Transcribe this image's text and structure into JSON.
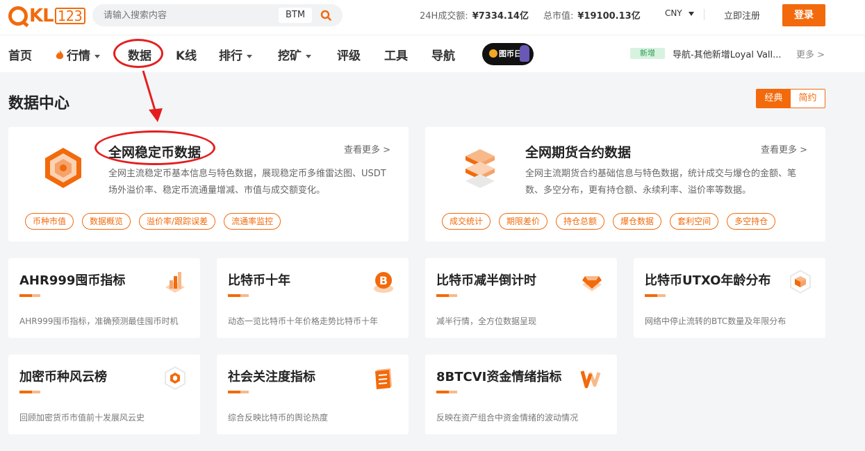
{
  "header": {
    "logo_main": "KL",
    "logo_num": "123",
    "search_placeholder": "请输入搜索内容",
    "search_tag": "BTM",
    "volume_label": "24H成交额:",
    "volume_value": "¥7334.14亿",
    "mcap_label": "总市值:",
    "mcap_value": "¥19100.13亿",
    "currency": "CNY",
    "register": "立即注册",
    "login": "登录"
  },
  "nav": {
    "items": [
      {
        "label": "首页"
      },
      {
        "label": "行情"
      },
      {
        "label": "数据"
      },
      {
        "label": "K线"
      },
      {
        "label": "排行"
      },
      {
        "label": "挖矿"
      },
      {
        "label": "评级"
      },
      {
        "label": "工具"
      },
      {
        "label": "导航"
      }
    ],
    "promo_text": "图币日",
    "new_tag": "新增",
    "news": "导航-其他新增Loyal Vall...",
    "more": "更多 >"
  },
  "page": {
    "title": "数据中心",
    "view_classic": "经典",
    "view_simple": "简约"
  },
  "big_cards": [
    {
      "title": "全网稳定币数据",
      "more": "查看更多 >",
      "desc": "全网主流稳定币基本信息与特色数据，展现稳定币多维雷达图、USDT场外溢价率、稳定币流通量增减、市值与成交额变化。",
      "tags": [
        "币种市值",
        "数据概览",
        "溢价率/跟踪误差",
        "流通率监控"
      ]
    },
    {
      "title": "全网期货合约数据",
      "more": "查看更多 >",
      "desc": "全网主流期货合约基础信息与特色数据，统计成交与爆仓的金额、笔数、多空分布，更有持仓额、永续利率、溢价率等数据。",
      "tags": [
        "成交统计",
        "期限差价",
        "持仓总额",
        "爆仓数据",
        "套利空间",
        "多空持仓"
      ]
    }
  ],
  "small_cards": [
    {
      "title": "AHR999囤币指标",
      "desc": "AHR999囤币指标，准确预测最佳囤币时机"
    },
    {
      "title": "比特币十年",
      "desc": "动态一览比特币十年价格走势比特币十年"
    },
    {
      "title": "比特币减半倒计时",
      "desc": "减半行情，全方位数据呈现"
    },
    {
      "title": "比特币UTXO年龄分布",
      "desc": "网络中停止流转的BTC数量及年限分布"
    },
    {
      "title": "加密币种风云榜",
      "desc": "回顾加密货币市值前十发展风云史"
    },
    {
      "title": "社会关注度指标",
      "desc": "综合反映比特币的舆论热度"
    },
    {
      "title": "8BTCVI资金情绪指标",
      "desc": "反映在资产组合中资金情绪的波动情况"
    }
  ],
  "colors": {
    "accent": "#f26a0b",
    "annotation": "#e41e1e"
  }
}
